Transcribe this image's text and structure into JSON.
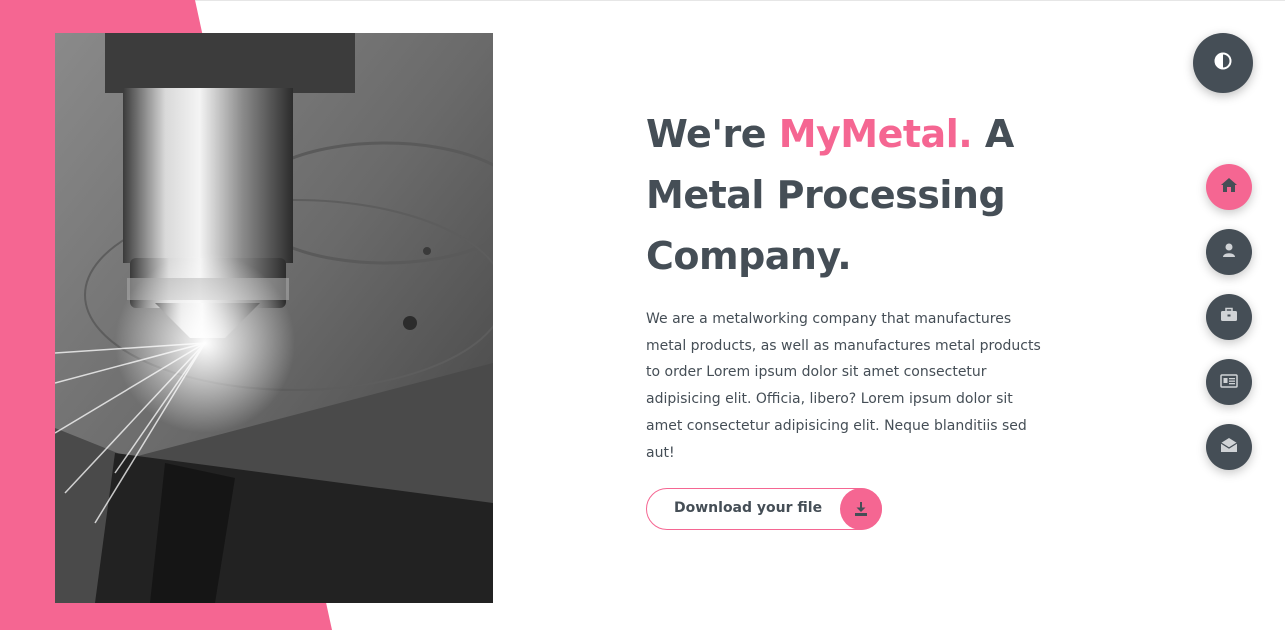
{
  "hero": {
    "headline_prefix": "We're ",
    "brand": "MyMetal.",
    "headline_suffix": " A Metal Processing Company.",
    "description": "We are a metalworking company that manufactures metal products, as well as manufactures metal products to order Lorem ipsum dolor sit amet consectetur adipisicing elit. Officia, libero? Lorem ipsum dolor sit amet consectetur adipisicing elit. Neque blanditiis sed aut!",
    "download_label": "Download your file",
    "image_icon": "laser-cutting-photo"
  },
  "theme_toggle": {
    "icon": "contrast-icon"
  },
  "nav": {
    "items": [
      {
        "icon": "home-icon",
        "active": true
      },
      {
        "icon": "user-icon",
        "active": false
      },
      {
        "icon": "briefcase-icon",
        "active": false
      },
      {
        "icon": "newspaper-icon",
        "active": false
      },
      {
        "icon": "envelope-open-icon",
        "active": false
      }
    ]
  },
  "colors": {
    "accent": "#f56692",
    "dark": "#454e56",
    "background": "#ffffff"
  }
}
